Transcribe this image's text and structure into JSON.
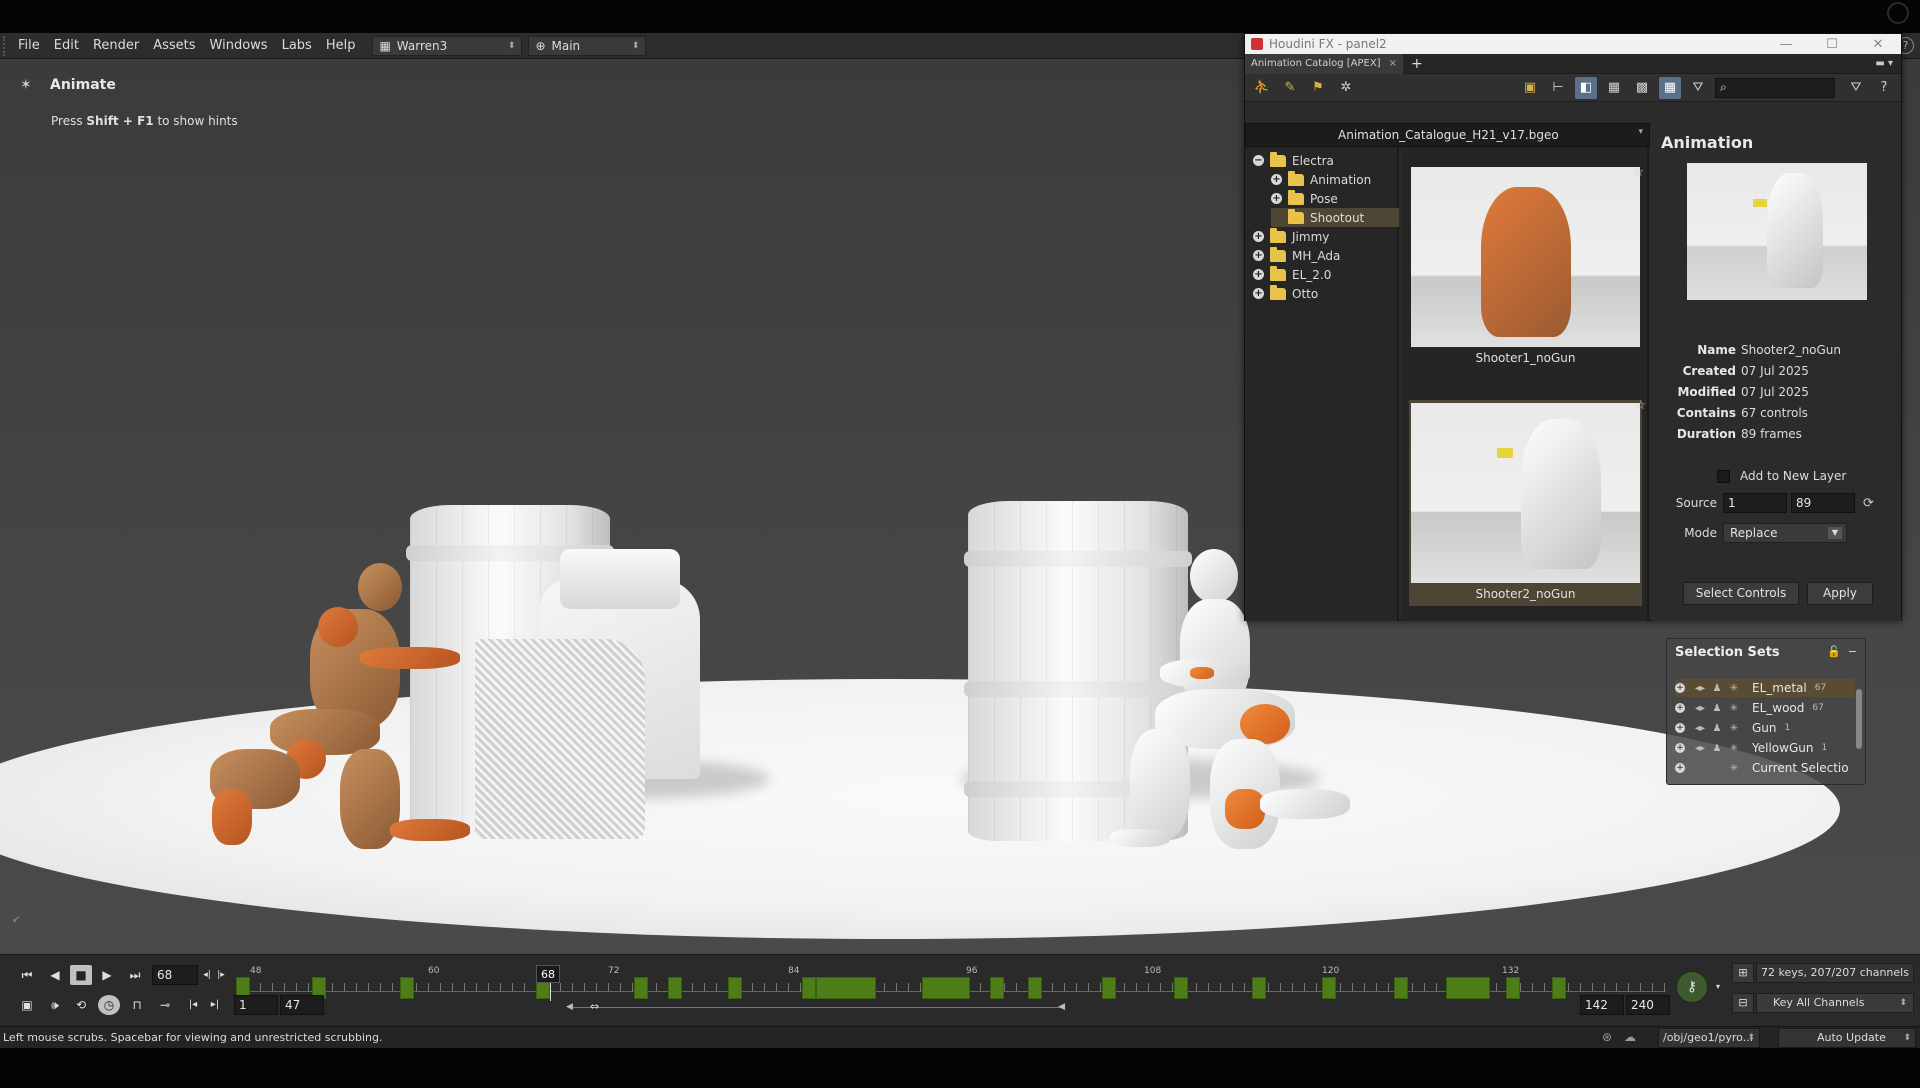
{
  "menubar": {
    "items": [
      "File",
      "Edit",
      "Render",
      "Assets",
      "Windows",
      "Labs",
      "Help"
    ],
    "desktop": "Warren3",
    "network": "Main"
  },
  "viewport": {
    "tool_name": "Animate",
    "hint_prefix": "Press ",
    "hint_keys": "Shift + F1",
    "hint_suffix": " to show hints"
  },
  "panel": {
    "window_title": "Houdini FX - panel2",
    "tab_label": "Animation Catalog [APEX]",
    "library_file": "Animation_Catalogue_H21_v17.bgeo",
    "tree": [
      {
        "label": "Electra",
        "level": 0,
        "expander": "−"
      },
      {
        "label": "Animation",
        "level": 1,
        "expander": "+"
      },
      {
        "label": "Pose",
        "level": 1,
        "expander": "+"
      },
      {
        "label": "Shootout",
        "level": 1,
        "expander": "",
        "selected": true
      },
      {
        "label": "Jimmy",
        "level": 0,
        "expander": "+"
      },
      {
        "label": "MH_Ada",
        "level": 0,
        "expander": "+"
      },
      {
        "label": "EL_2.0",
        "level": 0,
        "expander": "+"
      },
      {
        "label": "Otto",
        "level": 0,
        "expander": "+"
      }
    ],
    "thumbnails": [
      {
        "caption": "Shooter1_noGun"
      },
      {
        "caption": "Shooter2_noGun",
        "selected": true
      }
    ],
    "details": {
      "header": "Animation",
      "name_label": "Name",
      "name_value": "Shooter2_noGun",
      "created_label": "Created",
      "created_value": "07 Jul 2025",
      "modified_label": "Modified",
      "modified_value": "07 Jul 2025",
      "contains_label": "Contains",
      "contains_value": "67 controls",
      "duration_label": "Duration",
      "duration_value": "89 frames",
      "add_layer_label": "Add to New Layer",
      "source_label": "Source",
      "source_start": "1",
      "source_end": "89",
      "mode_label": "Mode",
      "mode_value": "Replace",
      "select_controls_label": "Select Controls",
      "apply_label": "Apply"
    }
  },
  "selection_sets": {
    "title": "Selection Sets",
    "items": [
      {
        "name": "EL_metal",
        "count": "67",
        "selected": true
      },
      {
        "name": "EL_wood",
        "count": "67"
      },
      {
        "name": "Gun",
        "count": "1"
      },
      {
        "name": "YellowGun",
        "count": "1"
      },
      {
        "name": "Current Selectio",
        "count": ""
      }
    ]
  },
  "timeline": {
    "current_frame": "68",
    "ruler_labels": [
      "48",
      "60",
      "72",
      "84",
      "96",
      "108",
      "120",
      "132"
    ],
    "cursor_label": "68",
    "range_start": "1",
    "range_start2": "47",
    "range_end": "142",
    "range_end2": "240",
    "key_info": "72 keys, 207/207 channels",
    "key_mode": "Key All Channels"
  },
  "status": {
    "message": "Left mouse scrubs. Spacebar for viewing and unrestricted scrubbing.",
    "path": "/obj/geo1/pyro...",
    "update_mode": "Auto Update"
  }
}
